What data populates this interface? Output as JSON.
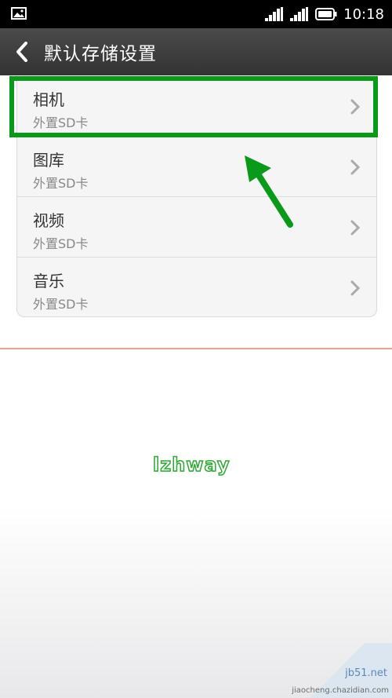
{
  "status_bar": {
    "time": "10:18"
  },
  "header": {
    "title": "默认存储设置"
  },
  "items": [
    {
      "title": "相机",
      "subtitle": "外置SD卡"
    },
    {
      "title": "图库",
      "subtitle": "外置SD卡"
    },
    {
      "title": "视频",
      "subtitle": "外置SD卡"
    },
    {
      "title": "音乐",
      "subtitle": "外置SD卡"
    }
  ],
  "watermark": {
    "text": "lzhway"
  },
  "site_watermark": {
    "domain": "jb51.net",
    "url": "jiaocheng.chazidian.com"
  },
  "colors": {
    "highlight": "#0a9a1a",
    "arrow": "#0a9a1a",
    "titlebar": "#3a3a3a",
    "divider": "#f0a090"
  }
}
